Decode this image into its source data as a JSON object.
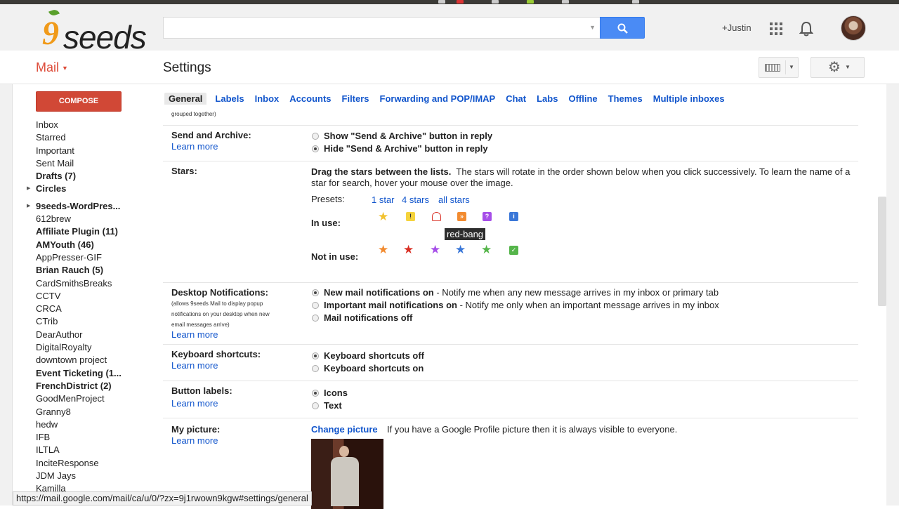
{
  "header": {
    "search_placeholder": "",
    "plus_user": "+Justin"
  },
  "subheader": {
    "mail_label": "Mail",
    "page_title": "Settings"
  },
  "sidebar": {
    "compose_label": "COMPOSE",
    "items": [
      {
        "label": "Inbox",
        "bold": false
      },
      {
        "label": "Starred",
        "bold": false
      },
      {
        "label": "Important",
        "bold": false
      },
      {
        "label": "Sent Mail",
        "bold": false
      },
      {
        "label": "Drafts (7)",
        "bold": true
      },
      {
        "label": "Circles",
        "bold": true
      },
      {
        "label": "9seeds-WordPres...",
        "bold": true
      },
      {
        "label": "612brew",
        "bold": false
      },
      {
        "label": "Affiliate Plugin (11)",
        "bold": true
      },
      {
        "label": "AMYouth (46)",
        "bold": true
      },
      {
        "label": "AppPresser-GIF",
        "bold": false
      },
      {
        "label": "Brian Rauch (5)",
        "bold": true
      },
      {
        "label": "CardSmithsBreaks",
        "bold": false
      },
      {
        "label": "CCTV",
        "bold": false
      },
      {
        "label": "CRCA",
        "bold": false
      },
      {
        "label": "CTrib",
        "bold": false
      },
      {
        "label": "DearAuthor",
        "bold": false
      },
      {
        "label": "DigitalRoyalty",
        "bold": false
      },
      {
        "label": "downtown project",
        "bold": false
      },
      {
        "label": "Event Ticketing (1...",
        "bold": true
      },
      {
        "label": "FrenchDistrict (2)",
        "bold": true
      },
      {
        "label": "GoodMenProject",
        "bold": false
      },
      {
        "label": "Granny8",
        "bold": false
      },
      {
        "label": "hedw",
        "bold": false
      },
      {
        "label": "IFB",
        "bold": false
      },
      {
        "label": "ILTLA",
        "bold": false
      },
      {
        "label": "InciteResponse",
        "bold": false
      },
      {
        "label": "JDM Jays",
        "bold": false
      },
      {
        "label": "Kamilla",
        "bold": false
      }
    ]
  },
  "tabs": [
    "General",
    "Labels",
    "Inbox",
    "Accounts",
    "Filters",
    "Forwarding and POP/IMAP",
    "Chat",
    "Labs",
    "Offline",
    "Themes",
    "Multiple inboxes"
  ],
  "settings": {
    "conversation_note": "grouped together)",
    "send_archive": {
      "label": "Send and Archive:",
      "learn_more": "Learn more",
      "options": [
        "Show \"Send & Archive\" button in reply",
        "Hide \"Send & Archive\" button in reply"
      ]
    },
    "stars": {
      "label": "Stars:",
      "instructions_bold": "Drag the stars between the lists.",
      "instructions": "The stars will rotate in the order shown below when you click successively. To learn the name of a star for search, hover your mouse over the image.",
      "presets_label": "Presets:",
      "presets": [
        "1 star",
        "4 stars",
        "all stars"
      ],
      "in_use_label": "In use:",
      "not_in_use_label": "Not in use:",
      "tooltip": "red-bang",
      "colors": {
        "yellow": "#f2c230",
        "orange": "#f28b30",
        "red": "#d93025",
        "purple": "#a64ee8",
        "blue": "#3a77d8",
        "green": "#55b54a"
      }
    },
    "desktop": {
      "label": "Desktop Notifications:",
      "note": "(allows 9seeds Mail to display popup notifications on your desktop when new email messages arrive)",
      "learn_more": "Learn more",
      "opt1_bold": "New mail notifications on",
      "opt1_desc": " - Notify me when any new message arrives in my inbox or primary tab",
      "opt2_bold": "Important mail notifications on",
      "opt2_desc": " - Notify me only when an important message arrives in my inbox",
      "opt3_bold": "Mail notifications off"
    },
    "keyboard": {
      "label": "Keyboard shortcuts:",
      "learn_more": "Learn more",
      "options": [
        "Keyboard shortcuts off",
        "Keyboard shortcuts on"
      ]
    },
    "button_labels": {
      "label": "Button labels:",
      "learn_more": "Learn more",
      "options": [
        "Icons",
        "Text"
      ]
    },
    "picture": {
      "label": "My picture:",
      "learn_more": "Learn more",
      "change_link": "Change picture",
      "desc": "If you have a Google Profile picture then it is always visible to everyone."
    }
  },
  "status_url": "https://mail.google.com/mail/ca/u/0/?zx=9j1rwown9kgw#settings/general"
}
